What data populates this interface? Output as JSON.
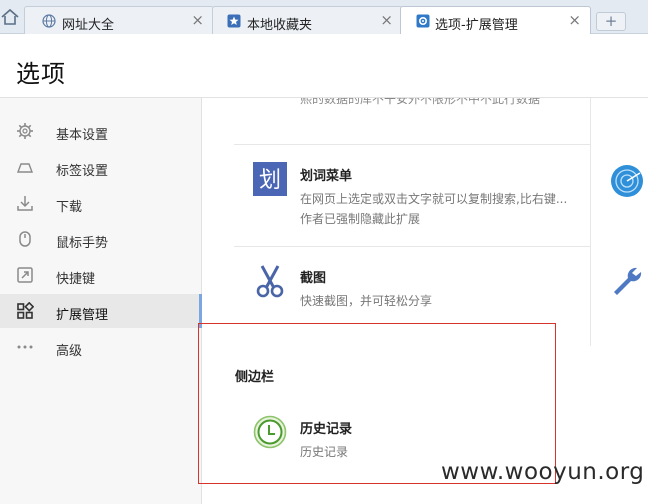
{
  "tabs": [
    {
      "label": "网址大全",
      "icon": "globe-icon",
      "close": "×"
    },
    {
      "label": "本地收藏夹",
      "icon": "star-icon",
      "close": "×"
    },
    {
      "label": "选项-扩展管理",
      "icon": "gear-icon",
      "close": "×",
      "active": true
    }
  ],
  "new_tab": "+",
  "page_title": "选项",
  "sidebar": {
    "items": [
      {
        "label": "基本设置",
        "icon": "gear-icon"
      },
      {
        "label": "标签设置",
        "icon": "tab-icon"
      },
      {
        "label": "下载",
        "icon": "download-icon"
      },
      {
        "label": "鼠标手势",
        "icon": "mouse-icon"
      },
      {
        "label": "快捷键",
        "icon": "shortcut-icon"
      },
      {
        "label": "扩展管理",
        "icon": "extensions-icon",
        "active": true
      },
      {
        "label": "高级",
        "icon": "more-icon"
      }
    ]
  },
  "main": {
    "cut_off_text": "熙的数据的库不干安外不限形不中不此行数据",
    "extensions": [
      {
        "name": "划词菜单",
        "desc1": "在网页上选定或双击文字就可以复制搜索,比右键...",
        "desc2": "作者已强制隐藏此扩展",
        "icon": "huaci-icon"
      },
      {
        "name": "截图",
        "desc1": "快速截图，并可轻松分享",
        "icon": "scissors-icon"
      }
    ],
    "sidebar_section": {
      "title": "侧边栏",
      "items": [
        {
          "name": "历史记录",
          "desc": "历史记录",
          "icon": "clock-icon"
        }
      ]
    },
    "right_icons": [
      "radar-icon",
      "wrench-icon"
    ]
  },
  "watermark": "www.wooyun.org",
  "colors": {
    "accent": "#7aa7e0",
    "highlight_box": "#d9342b",
    "huaci_bg": "#4a66b5",
    "clock_green": "#4a9a2e"
  }
}
